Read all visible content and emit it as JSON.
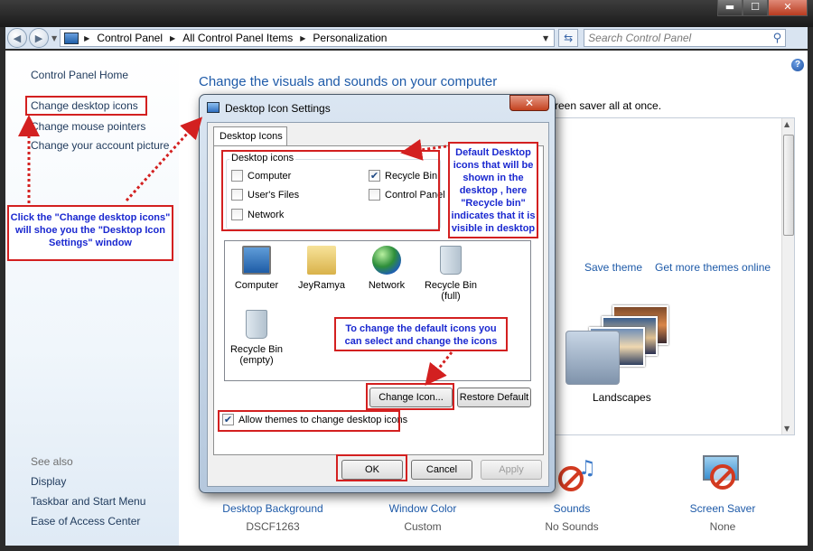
{
  "window": {
    "controls": {
      "minimize": "▬",
      "maximize": "☐",
      "close": "✕"
    }
  },
  "address_bar": {
    "crumbs": [
      "Control Panel",
      "All Control Panel Items",
      "Personalization"
    ],
    "search_placeholder": "Search Control Panel"
  },
  "sidebar": {
    "home": "Control Panel Home",
    "links": [
      "Change desktop icons",
      "Change mouse pointers",
      "Change your account picture"
    ],
    "see_also_header": "See also",
    "see_also": [
      "Display",
      "Taskbar and Start Menu",
      "Ease of Access Center"
    ]
  },
  "main": {
    "title": "Change the visuals and sounds on your computer",
    "description_visible": "reen saver all at once.",
    "save_theme": "Save theme",
    "more_themes": "Get more themes online",
    "landscapes_label": "Landscapes",
    "bottom": [
      {
        "label": "Desktop Background",
        "value": "DSCF1263"
      },
      {
        "label": "Window Color",
        "value": "Custom"
      },
      {
        "label": "Sounds",
        "value": "No Sounds"
      },
      {
        "label": "Screen Saver",
        "value": "None"
      }
    ]
  },
  "dialog": {
    "title": "Desktop Icon Settings",
    "close": "✕",
    "tab": "Desktop Icons",
    "group_label": "Desktop icons",
    "checkboxes": [
      {
        "label": "Computer",
        "checked": false
      },
      {
        "label": "Recycle Bin",
        "checked": true
      },
      {
        "label": "User's Files",
        "checked": false
      },
      {
        "label": "Control Panel",
        "checked": false
      },
      {
        "label": "Network",
        "checked": false
      }
    ],
    "icons": [
      "Computer",
      "JeyRamya",
      "Network",
      "Recycle Bin (full)",
      "Recycle Bin (empty)"
    ],
    "change_icon": "Change Icon...",
    "restore_default": "Restore Default",
    "allow_themes": "Allow themes to change desktop icons",
    "allow_themes_checked": true,
    "ok": "OK",
    "cancel": "Cancel",
    "apply": "Apply"
  },
  "annotations": {
    "click_note": "Click the \"Change desktop icons\" will shoe you the \"Desktop Icon Settings\" window",
    "default_note": "Default Desktop icons that will be shown in the desktop , here \"Recycle bin\" indicates that it is visible in desktop",
    "change_note": "To change the default icons you can select and change the icons"
  }
}
